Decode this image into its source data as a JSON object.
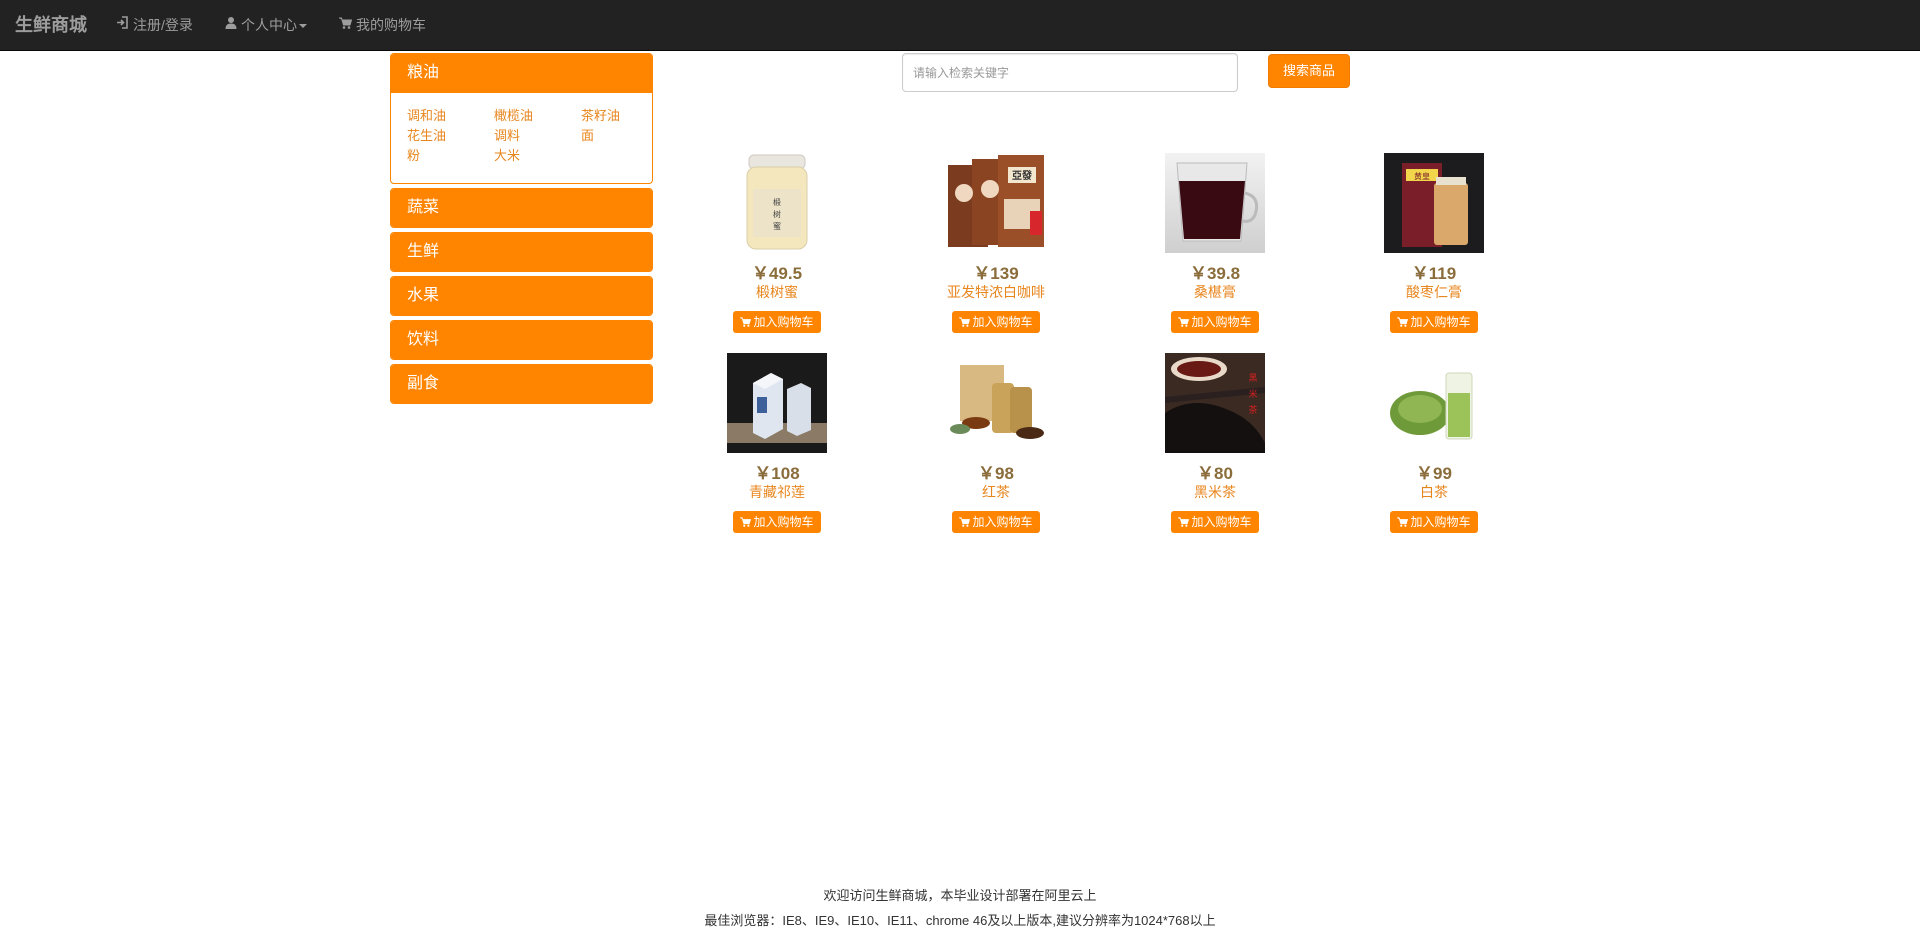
{
  "navbar": {
    "brand": "生鲜商城",
    "login": "注册/登录",
    "user_center": "个人中心",
    "cart": "我的购物车"
  },
  "categories": [
    {
      "name": "粮油",
      "expanded": true,
      "subcategories": [
        "调和油",
        "橄榄油",
        "茶籽油",
        "花生油",
        "调料",
        "面",
        "粉",
        "大米"
      ]
    },
    {
      "name": "蔬菜"
    },
    {
      "name": "生鲜"
    },
    {
      "name": "水果"
    },
    {
      "name": "饮料"
    },
    {
      "name": "副食"
    }
  ],
  "search": {
    "placeholder": "请输入检索关键字",
    "button": "搜索商品"
  },
  "products": [
    {
      "price": "￥49.5",
      "name": "椴树蜜"
    },
    {
      "price": "￥139",
      "name": "亚发特浓白咖啡"
    },
    {
      "price": "￥39.8",
      "name": "桑椹膏"
    },
    {
      "price": "￥119",
      "name": "酸枣仁膏"
    },
    {
      "price": "￥108",
      "name": "青藏祁莲"
    },
    {
      "price": "￥98",
      "name": "红茶"
    },
    {
      "price": "￥80",
      "name": "黑米茶"
    },
    {
      "price": "￥99",
      "name": "白茶"
    }
  ],
  "add_to_cart": "加入购物车",
  "footer": {
    "line1": "欢迎访问生鲜商城，本毕业设计部署在阿里云上",
    "line2": "最佳浏览器：IE8、IE9、IE10、IE11、chrome 46及以上版本,建议分辨率为1024*768以上"
  },
  "colors": {
    "accent": "#ff8400",
    "navbar_bg": "#222222",
    "nav_text": "#9d9d9d",
    "price": "#8a6d3b",
    "link": "#e8861e"
  }
}
